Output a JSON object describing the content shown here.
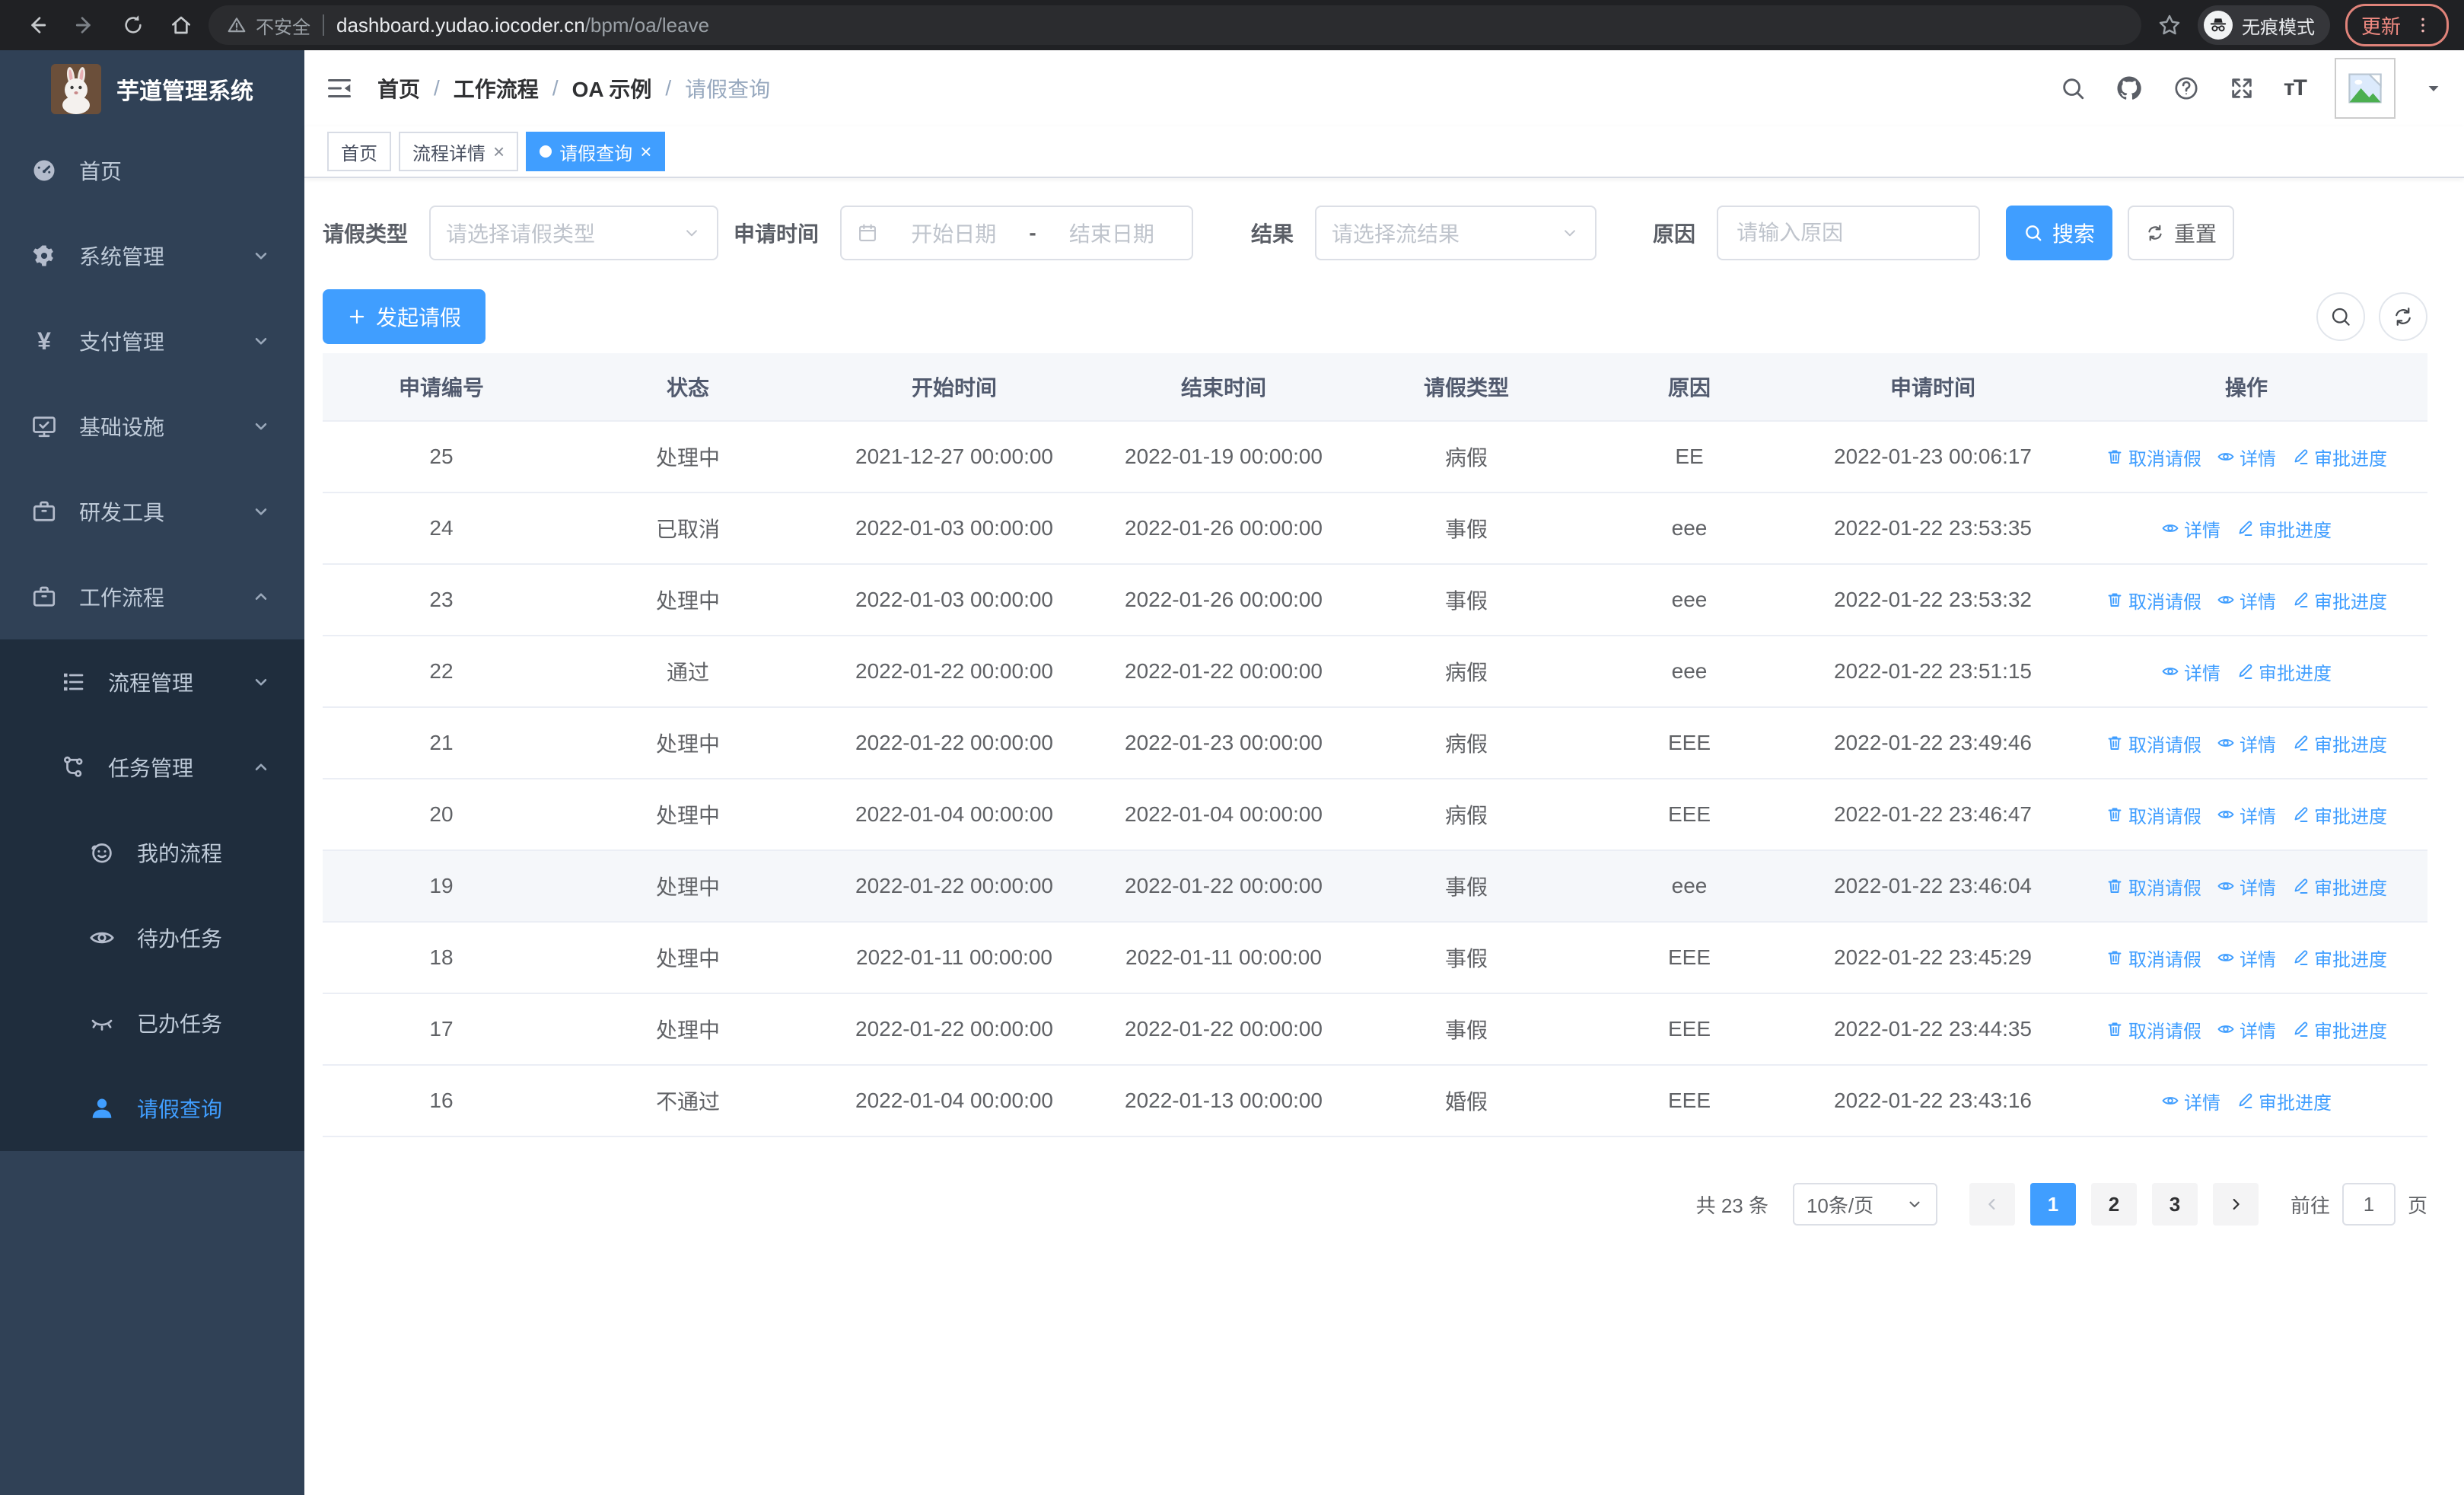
{
  "colors": {
    "accent": "#409eff",
    "sidebar_bg": "#304156",
    "submenu_bg": "#1f2d3d",
    "update_badge": "#f28b82"
  },
  "browser": {
    "security_label": "不安全",
    "url_host": "dashboard.yudao.iocoder.cn",
    "url_path": "/bpm/oa/leave",
    "incognito_label": "无痕模式",
    "update_label": "更新"
  },
  "sidebar": {
    "title": "芋道管理系统",
    "menu": [
      {
        "label": "首页",
        "icon": "dashboard-icon",
        "level": 0
      },
      {
        "label": "系统管理",
        "icon": "gear-icon",
        "level": 0,
        "chevron": "down"
      },
      {
        "label": "支付管理",
        "icon": "yen-icon",
        "glyph": "¥",
        "level": 0,
        "chevron": "down"
      },
      {
        "label": "基础设施",
        "icon": "monitor-icon",
        "level": 0,
        "chevron": "down"
      },
      {
        "label": "研发工具",
        "icon": "briefcase-icon",
        "level": 0,
        "chevron": "down"
      },
      {
        "label": "工作流程",
        "icon": "briefcase-icon",
        "level": 0,
        "chevron": "up"
      },
      {
        "label": "流程管理",
        "icon": "list-icon",
        "level": 1,
        "chevron": "down",
        "dark": true
      },
      {
        "label": "任务管理",
        "icon": "org-icon",
        "level": 1,
        "chevron": "up",
        "dark": true
      },
      {
        "label": "我的流程",
        "icon": "robot-icon",
        "level": 2,
        "dark": true
      },
      {
        "label": "待办任务",
        "icon": "eye-open-icon",
        "level": 2,
        "dark": true
      },
      {
        "label": "已办任务",
        "icon": "eye-closed-icon",
        "level": 2,
        "dark": true
      },
      {
        "label": "请假查询",
        "icon": "user-icon",
        "level": 2,
        "dark": true,
        "active": true
      }
    ]
  },
  "header": {
    "separator": "/",
    "breadcrumb": [
      {
        "label": "首页"
      },
      {
        "label": "工作流程"
      },
      {
        "label": "OA 示例"
      },
      {
        "label": "请假查询",
        "current": true
      }
    ]
  },
  "tabs": [
    {
      "label": "首页"
    },
    {
      "label": "流程详情",
      "closable": true
    },
    {
      "label": "请假查询",
      "closable": true,
      "active": true
    }
  ],
  "filters": {
    "leave_type_label": "请假类型",
    "leave_type_placeholder": "请选择请假类型",
    "apply_time_label": "申请时间",
    "start_date_placeholder": "开始日期",
    "range_separator": "-",
    "end_date_placeholder": "结束日期",
    "result_label": "结果",
    "result_placeholder": "请选择流结果",
    "reason_label": "原因",
    "reason_placeholder": "请输入原因",
    "search_label": "搜索",
    "reset_label": "重置"
  },
  "toolbar": {
    "create_label": "发起请假"
  },
  "table": {
    "columns": [
      "申请编号",
      "状态",
      "开始时间",
      "结束时间",
      "请假类型",
      "原因",
      "申请时间",
      "操作"
    ],
    "action_labels": {
      "cancel": "取消请假",
      "detail": "详情",
      "progress": "审批进度"
    },
    "rows": [
      {
        "id": "25",
        "status": "处理中",
        "start": "2021-12-27 00:00:00",
        "end": "2022-01-19 00:00:00",
        "type": "病假",
        "reason": "EE",
        "apply_time": "2022-01-23 00:06:17",
        "actions": [
          "cancel",
          "detail",
          "progress"
        ]
      },
      {
        "id": "24",
        "status": "已取消",
        "start": "2022-01-03 00:00:00",
        "end": "2022-01-26 00:00:00",
        "type": "事假",
        "reason": "eee",
        "apply_time": "2022-01-22 23:53:35",
        "actions": [
          "detail",
          "progress"
        ]
      },
      {
        "id": "23",
        "status": "处理中",
        "start": "2022-01-03 00:00:00",
        "end": "2022-01-26 00:00:00",
        "type": "事假",
        "reason": "eee",
        "apply_time": "2022-01-22 23:53:32",
        "actions": [
          "cancel",
          "detail",
          "progress"
        ]
      },
      {
        "id": "22",
        "status": "通过",
        "start": "2022-01-22 00:00:00",
        "end": "2022-01-22 00:00:00",
        "type": "病假",
        "reason": "eee",
        "apply_time": "2022-01-22 23:51:15",
        "actions": [
          "detail",
          "progress"
        ]
      },
      {
        "id": "21",
        "status": "处理中",
        "start": "2022-01-22 00:00:00",
        "end": "2022-01-23 00:00:00",
        "type": "病假",
        "reason": "EEE",
        "apply_time": "2022-01-22 23:49:46",
        "actions": [
          "cancel",
          "detail",
          "progress"
        ]
      },
      {
        "id": "20",
        "status": "处理中",
        "start": "2022-01-04 00:00:00",
        "end": "2022-01-04 00:00:00",
        "type": "病假",
        "reason": "EEE",
        "apply_time": "2022-01-22 23:46:47",
        "actions": [
          "cancel",
          "detail",
          "progress"
        ]
      },
      {
        "id": "19",
        "status": "处理中",
        "start": "2022-01-22 00:00:00",
        "end": "2022-01-22 00:00:00",
        "type": "事假",
        "reason": "eee",
        "apply_time": "2022-01-22 23:46:04",
        "actions": [
          "cancel",
          "detail",
          "progress"
        ],
        "highlight": true
      },
      {
        "id": "18",
        "status": "处理中",
        "start": "2022-01-11 00:00:00",
        "end": "2022-01-11 00:00:00",
        "type": "事假",
        "reason": "EEE",
        "apply_time": "2022-01-22 23:45:29",
        "actions": [
          "cancel",
          "detail",
          "progress"
        ]
      },
      {
        "id": "17",
        "status": "处理中",
        "start": "2022-01-22 00:00:00",
        "end": "2022-01-22 00:00:00",
        "type": "事假",
        "reason": "EEE",
        "apply_time": "2022-01-22 23:44:35",
        "actions": [
          "cancel",
          "detail",
          "progress"
        ]
      },
      {
        "id": "16",
        "status": "不通过",
        "start": "2022-01-04 00:00:00",
        "end": "2022-01-13 00:00:00",
        "type": "婚假",
        "reason": "EEE",
        "apply_time": "2022-01-22 23:43:16",
        "actions": [
          "detail",
          "progress"
        ]
      }
    ]
  },
  "pagination": {
    "total": "共 23 条",
    "page_size": "10条/页",
    "pages": [
      "1",
      "2",
      "3"
    ],
    "active_page": "1",
    "goto_label": "前往",
    "goto_value": "1",
    "page_suffix": "页"
  }
}
